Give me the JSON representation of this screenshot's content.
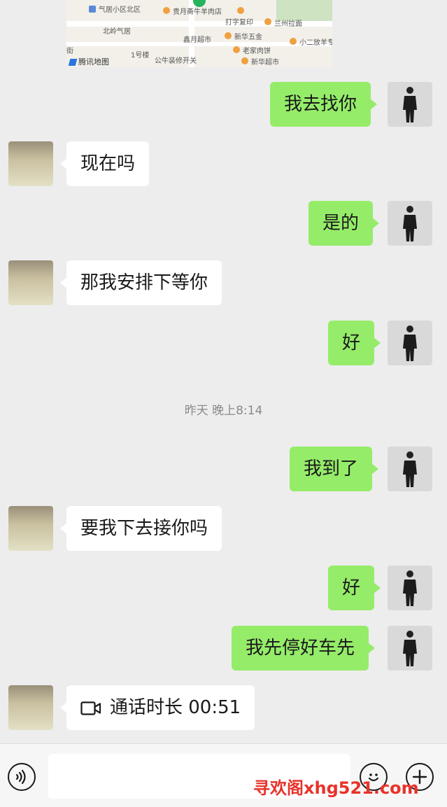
{
  "map": {
    "brand": "腾讯地图",
    "labels": [
      "气居小区北区",
      "贵月斋牛羊肉店",
      "北岭气居",
      "打字复印",
      "兰州拉面",
      "鑫月超市",
      "新华五金",
      "小二放羊专卖",
      "街",
      "1号楼",
      "老家肉饼",
      "公牛装修开关",
      "新华超市"
    ]
  },
  "messages": [
    {
      "side": "me",
      "text": "我去找你"
    },
    {
      "side": "her",
      "text": "现在吗"
    },
    {
      "side": "me",
      "text": "是的"
    },
    {
      "side": "her",
      "text": "那我安排下等你"
    },
    {
      "side": "me",
      "text": "好"
    },
    {
      "side": "me",
      "text": "我到了"
    },
    {
      "side": "her",
      "text": "要我下去接你吗"
    },
    {
      "side": "me",
      "text": "好"
    },
    {
      "side": "me",
      "text": "我先停好车先"
    },
    {
      "side": "her",
      "text": "通话时长 00:51",
      "icon": "video-call-icon"
    }
  ],
  "timestamp": "昨天 晚上8:14",
  "input_bar": {
    "voice_icon": "voice-icon",
    "emoji_icon": "emoji-icon",
    "plus_icon": "plus-icon",
    "input_value": ""
  },
  "watermark": "寻欢阁xhg521.com",
  "colors": {
    "background": "#ededed",
    "my_bubble": "#95ec69",
    "her_bubble": "#ffffff",
    "watermark": "#e8332a"
  }
}
